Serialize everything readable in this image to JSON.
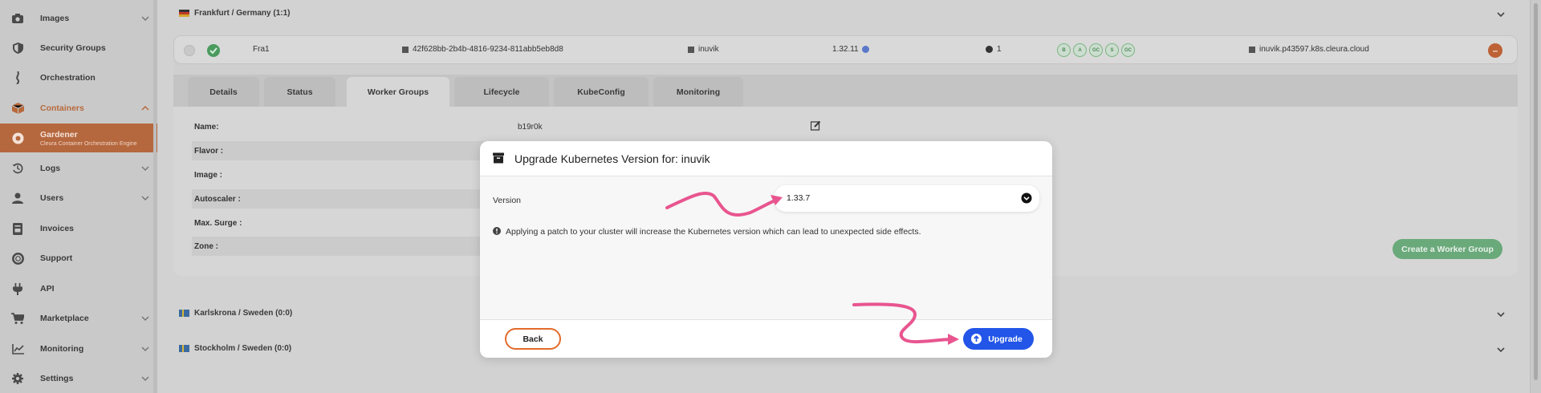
{
  "sidebar": {
    "items": [
      {
        "label": "Images",
        "icon": "camera-icon",
        "chevron": true
      },
      {
        "label": "Security Groups",
        "icon": "shield-icon",
        "chevron": false
      },
      {
        "label": "Orchestration",
        "icon": "orchestration-icon",
        "chevron": false
      },
      {
        "label": "Containers",
        "icon": "containers-icon",
        "chevron": true
      },
      {
        "label": "Gardener",
        "sub": "Cleura Container Orchestration Engine",
        "icon": "gardener-icon"
      },
      {
        "label": "Logs",
        "icon": "history-icon",
        "chevron": true
      },
      {
        "label": "Users",
        "icon": "user-icon",
        "chevron": true
      },
      {
        "label": "Invoices",
        "icon": "invoice-icon",
        "chevron": false
      },
      {
        "label": "Support",
        "icon": "lifebuoy-icon",
        "chevron": false
      },
      {
        "label": "API",
        "icon": "plug-icon",
        "chevron": false
      },
      {
        "label": "Marketplace",
        "icon": "cart-icon",
        "chevron": true
      },
      {
        "label": "Monitoring",
        "icon": "chart-icon",
        "chevron": true
      },
      {
        "label": "Settings",
        "icon": "gear-icon",
        "chevron": true
      }
    ]
  },
  "regions": {
    "frankfurt": "Frankfurt / Germany (1:1)",
    "karlskrona": "Karlskrona / Sweden (0:0)",
    "stockholm": "Stockholm / Sweden (0:0)"
  },
  "cluster": {
    "name": "Fra1",
    "id": "42f628bb-2b4b-4816-9234-811abb5eb8d8",
    "project": "inuvik",
    "version": "1.32.11",
    "nodes": "1",
    "host": "inuvik.p43597.k8s.cleura.cloud",
    "chips": [
      "B",
      "A",
      "GC",
      "S",
      "GC"
    ]
  },
  "tabs": [
    "Details",
    "Status",
    "Worker Groups",
    "Lifecycle",
    "KubeConfig",
    "Monitoring"
  ],
  "worker_form": {
    "name_label": "Name:",
    "name_value": "b19r0k",
    "flavor_label": "Flavor :",
    "image_label": "Image :",
    "autoscaler_label": "Autoscaler :",
    "maxsurge_label": "Max. Surge :",
    "zone_label": "Zone :"
  },
  "create_button": "Create a Worker Group",
  "modal": {
    "title": "Upgrade Kubernetes Version for: inuvik",
    "version_label": "Version",
    "version_value": "1.33.7",
    "info": "Applying a patch to your cluster will increase the Kubernetes version which can lead to unexpected side effects.",
    "back": "Back",
    "upgrade": "Upgrade"
  },
  "colors": {
    "accent": "#e36a2a",
    "primary": "#2255e8",
    "annotation": "#e8558f"
  }
}
